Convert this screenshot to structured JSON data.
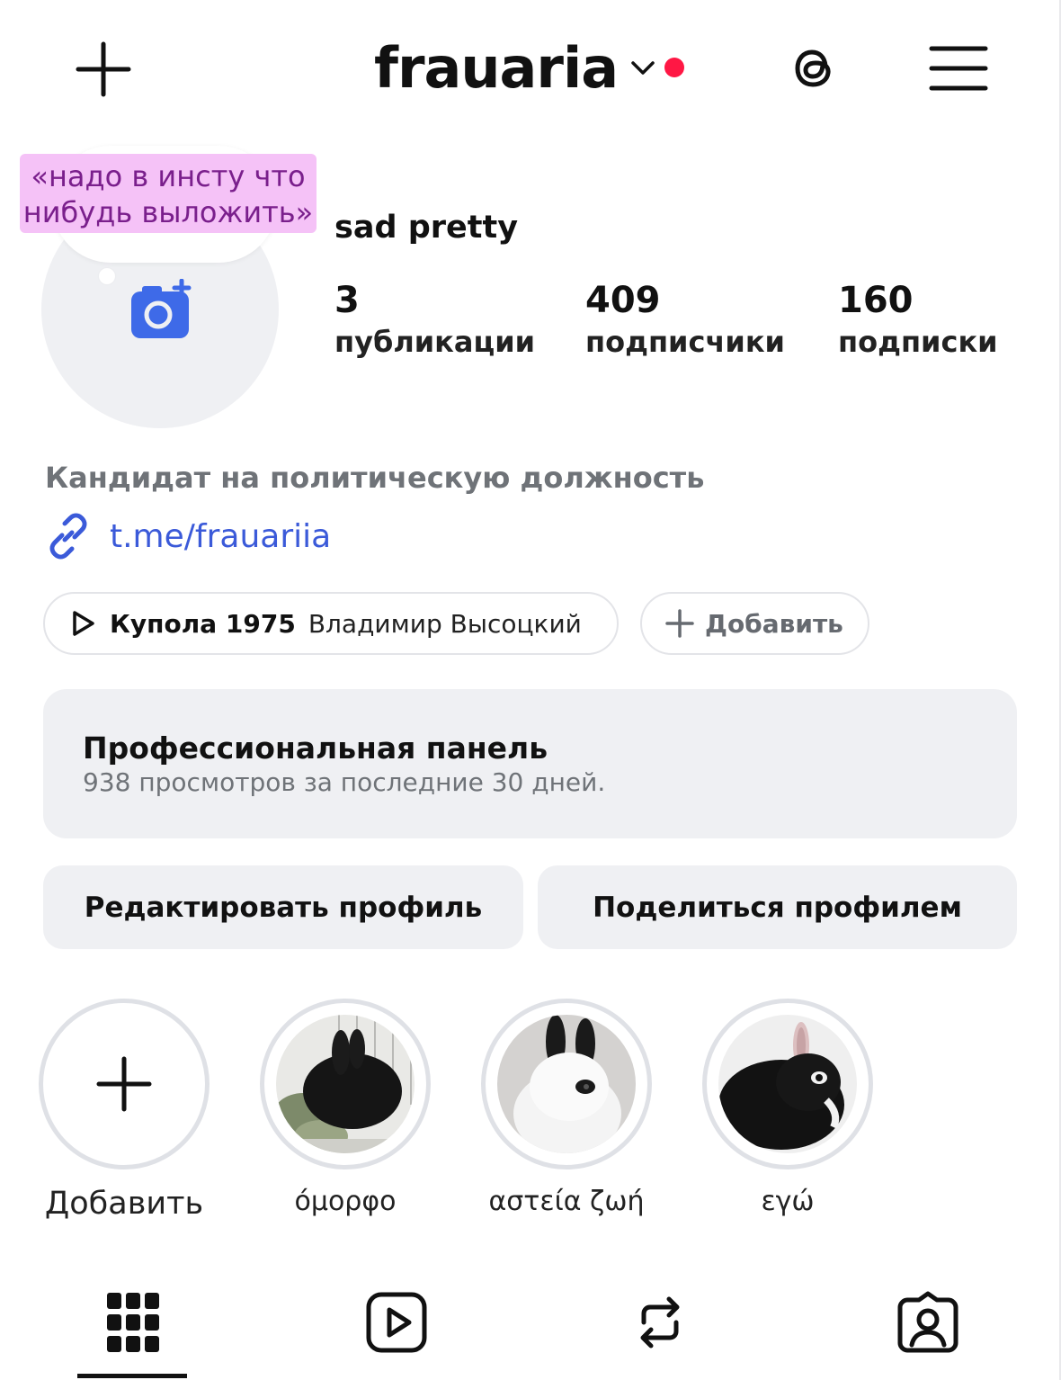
{
  "header": {
    "username": "frauaria",
    "create_icon": "plus-icon",
    "threads_icon": "threads-icon",
    "menu_icon": "hamburger-menu-icon"
  },
  "note": {
    "line1": "«надо в инсту что",
    "line2": "нибудь выложить»"
  },
  "profile": {
    "display_name": "sad pretty",
    "stats": [
      {
        "value": "3",
        "label": "публикации"
      },
      {
        "value": "409",
        "label": "подписчики"
      },
      {
        "value": "160",
        "label": "подписки"
      }
    ],
    "bio": "Кандидат на политическую должность",
    "link": "t.me/frauariia"
  },
  "music": {
    "song": "Купола 1975",
    "artist": "Владимир Высоцкий"
  },
  "add_link_label": "Добавить",
  "pro_panel": {
    "title": "Профессиональная панель",
    "subtitle": "938 просмотров за последние 30 дней."
  },
  "buttons": {
    "edit": "Редактировать профиль",
    "share": "Поделиться профилем"
  },
  "highlights": [
    {
      "label": "Добавить"
    },
    {
      "label": "όμορφο"
    },
    {
      "label": "αστεία ζωή"
    },
    {
      "label": "εγώ"
    }
  ],
  "tabs": [
    "grid-icon",
    "reels-icon",
    "reposts-icon",
    "tagged-icon"
  ],
  "colors": {
    "accent_link": "#3b5ad9",
    "camera_icon": "#3e6ae8",
    "notification_dot": "#ff1744",
    "note_bg": "#f5c2f7",
    "note_text": "#7a1f8c"
  }
}
